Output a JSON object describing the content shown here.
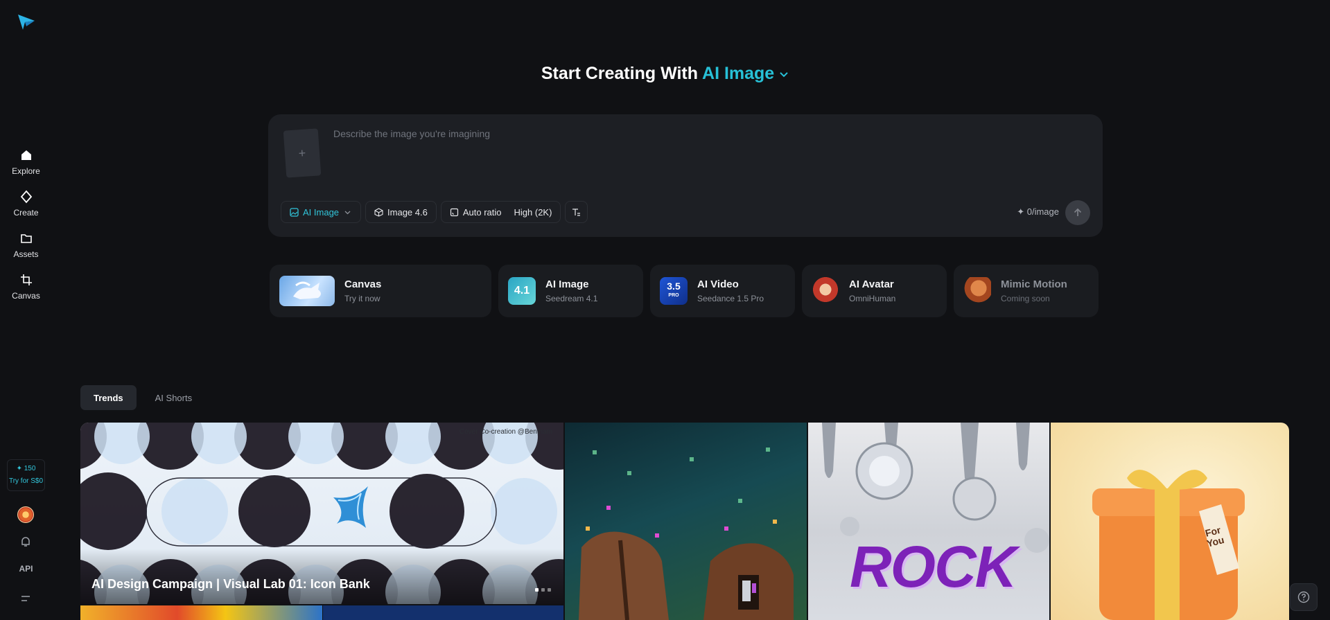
{
  "sidebar": {
    "nav": [
      {
        "label": "Explore",
        "icon": "home-icon"
      },
      {
        "label": "Create",
        "icon": "diamond-icon"
      },
      {
        "label": "Assets",
        "icon": "folder-icon"
      },
      {
        "label": "Canvas",
        "icon": "crop-icon"
      }
    ],
    "credits": "✦ 150",
    "trial": "Try for S$0",
    "api": "API"
  },
  "hero": {
    "title_prefix": "Start Creating With",
    "title_accent": "AI Image"
  },
  "prompt": {
    "placeholder": "Describe the image you're imagining",
    "upload_symbol": "+",
    "mode": "AI Image",
    "model": "Image 4.6",
    "ratio": "Auto ratio",
    "quality": "High (2K)",
    "cost": "✦ 0/image"
  },
  "tools": [
    {
      "name": "Canvas",
      "sub": "Try it now"
    },
    {
      "name": "AI Image",
      "sub": "Seedream 4.1",
      "badge": "4.1"
    },
    {
      "name": "AI Video",
      "sub": "Seedance 1.5 Pro",
      "badge": "3.5",
      "badge_sub": "PRO"
    },
    {
      "name": "AI Avatar",
      "sub": "OmniHuman"
    },
    {
      "name": "Mimic Motion",
      "sub": "Coming soon"
    }
  ],
  "tabs": [
    {
      "label": "Trends",
      "active": true
    },
    {
      "label": "AI Shorts",
      "active": false
    }
  ],
  "gallery": {
    "featured_tag": "Cover Co-creation @Bentham",
    "featured_title": "AI Design Campaign | Visual Lab 01: Icon Bank",
    "rock_text": "ROCK",
    "gift_tag": "For You"
  },
  "colors": {
    "background": "#101114",
    "accent": "#27c1d7",
    "panel": "#1d1f24"
  }
}
